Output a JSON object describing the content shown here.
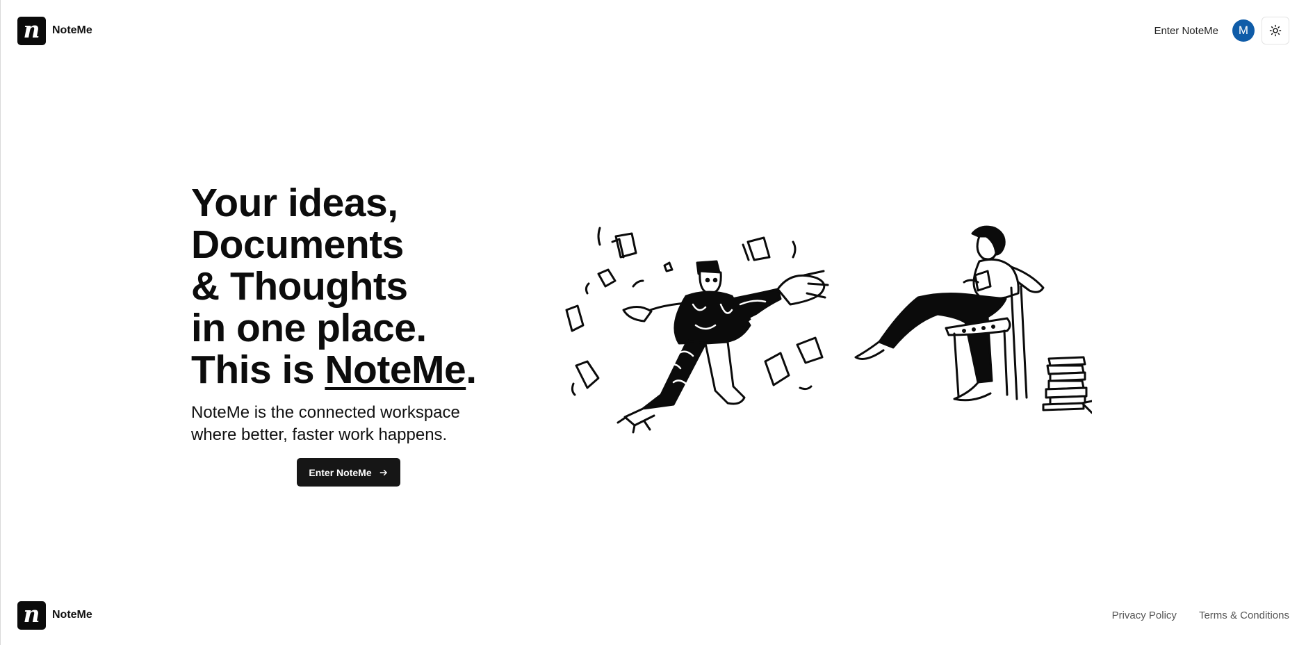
{
  "header": {
    "brand_name": "NoteMe",
    "logo_letter": "n",
    "enter_link": "Enter NoteMe",
    "avatar_initial": "M",
    "avatar_color": "#0f5ca8",
    "theme_icon": "sun-icon"
  },
  "hero": {
    "headline_lines": [
      "Your ideas,",
      "Documents",
      "& Thoughts",
      "in one place."
    ],
    "headline_last_prefix": "This is ",
    "headline_brand": "NoteMe",
    "headline_last_suffix": ".",
    "subtitle_lines": [
      "NoteMe is the connected workspace",
      "where better, faster work happens."
    ],
    "cta_label": "Enter NoteMe",
    "cta_icon": "arrow-right-icon"
  },
  "illustration": {
    "left": "person-running-with-papers",
    "right": "person-reading-on-chair"
  },
  "footer": {
    "brand_name": "NoteMe",
    "logo_letter": "n",
    "privacy": "Privacy Policy",
    "terms": "Terms & Conditions"
  }
}
